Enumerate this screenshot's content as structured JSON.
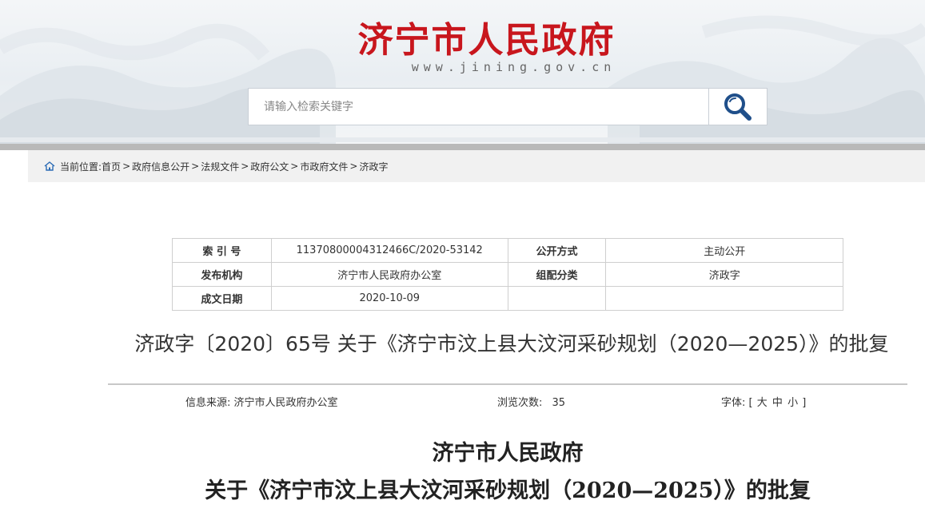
{
  "header": {
    "site_title": "济宁市人民政府",
    "site_url": "www.jining.gov.cn",
    "title_color": "#c8161d"
  },
  "search": {
    "placeholder": "请输入检索关键字",
    "button_icon": "search-icon",
    "icon_color": "#1f4f8a"
  },
  "breadcrumb": {
    "prefix": "当前位置:",
    "home_icon": "home-icon",
    "items": [
      "首页",
      "政府信息公开",
      "法规文件",
      "政府公文",
      "市政府文件",
      "济政字"
    ],
    "separator": ">"
  },
  "meta": {
    "index_label": "索 引 号",
    "index_value": "11370800004312466C/2020-53142",
    "disclosure_label": "公开方式",
    "disclosure_value": "主动公开",
    "publisher_label": "发布机构",
    "publisher_value": "济宁市人民政府办公室",
    "category_label": "组配分类",
    "category_value": "济政字",
    "date_label": "成文日期",
    "date_value": "2020-10-09"
  },
  "document": {
    "title": "济政字〔2020〕65号 关于《济宁市汶上县大汶河采砂规划（2020—2025）》的批复",
    "source_label": "信息来源:",
    "source_value": "济宁市人民政府办公室",
    "views_label": "浏览次数:",
    "views_value": "35",
    "font_label": "字体:",
    "font_open": "[",
    "font_large": "大",
    "font_medium": "中",
    "font_small": "小",
    "font_close": "]",
    "heading_line1": "济宁市人民政府",
    "heading_line2": "关于《济宁市汶上县大汶河采砂规划（2020—2025）》的批复"
  }
}
